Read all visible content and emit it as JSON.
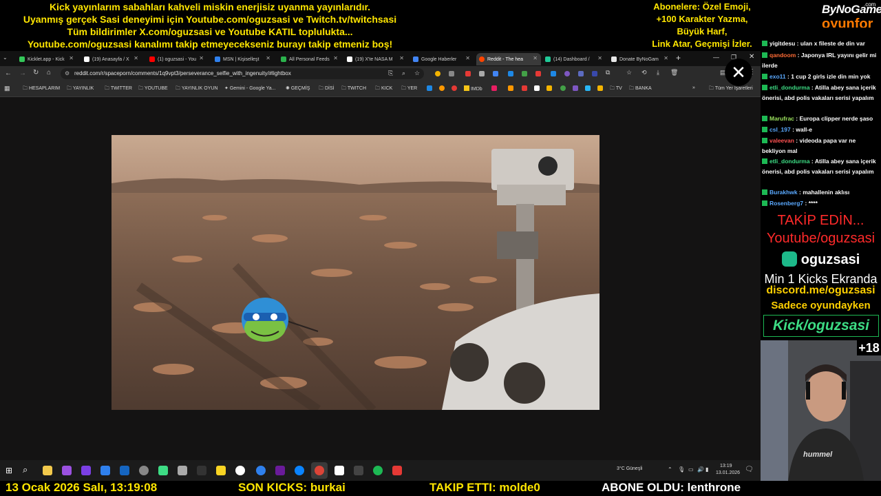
{
  "top_banner": {
    "lines": [
      "Kick yayınlarım sabahları kahveli miskin enerjisiz uyanma yayınlarıdır.",
      "Uyanmış gerçek Sasi deneyimi için Youtube.com/oguzsasi ve Twitch.tv/twitchsasi",
      "Tüm bildirimler X.com/oguzsasi ve Youtube KATIL topluluktа...",
      "Youtube.com/oguzsasi kanalımı takip etmeyecekseniz burayı takip etmeniz boş!"
    ],
    "sub_lines": [
      "Abonelere: Özel Emoji,",
      "+100 Karakter Yazma,",
      "Büyük Harf,",
      "Link Atar, Geçmişi İzler."
    ],
    "logo_top": "ByNoGame",
    "logo_small": ".com",
    "logo_bottom": "oyunfor",
    "colors": {
      "banner_text": "#ffe600",
      "logo_orange": "#ff7a00"
    }
  },
  "browser": {
    "tabs": [
      {
        "label": "Kicklet.app - Kick",
        "icon": "kicklet-icon",
        "color": "#34c759"
      },
      {
        "label": "(19) Anasayfa / X",
        "icon": "x-icon",
        "color": "#ffffff"
      },
      {
        "label": "(1) oguzsasi - You",
        "icon": "youtube-icon",
        "color": "#ff0000"
      },
      {
        "label": "MSN | Kişiselleşt",
        "icon": "msn-icon",
        "color": "#2f80ed"
      },
      {
        "label": "All Personal Feeds",
        "icon": "feedly-icon",
        "color": "#2bb24c"
      },
      {
        "label": "(19) X'te NASA M",
        "icon": "x-icon",
        "color": "#ffffff"
      },
      {
        "label": "Google Haberler",
        "icon": "google-news-icon",
        "color": "#4285f4"
      },
      {
        "label": "Reddit - The hea",
        "icon": "reddit-icon",
        "color": "#ff4500"
      },
      {
        "label": "(14) Dashboard /",
        "icon": "dashboard-icon",
        "color": "#20c997"
      },
      {
        "label": "Donate ByNoGam",
        "icon": "bynogame-icon",
        "color": "#e8e8e8"
      }
    ],
    "active_tab_index": 7,
    "new_tab": "+",
    "url": "reddit.com/r/spaceporn/comments/1q9vpt3/perseverance_selfie_with_ingenuity/#lightbox",
    "bookmarks": [
      "HESAPLARIM",
      "YAYINLIK",
      "TWITTER",
      "YOUTUBE",
      "YAYINLIK OYUN",
      "Gemini - Google Ya...",
      "GEÇMİŞ",
      "DİSİ",
      "TWITCH",
      "KICK",
      "YER",
      "IMDb",
      "TV",
      "BANKA"
    ],
    "all_bookmarks": "Tüm Yer İşaretleri",
    "close_symbol": "✕"
  },
  "taskbar": {
    "weather": "3°C  Güneşli",
    "time": "13:19",
    "date": "13.01.2026"
  },
  "chat": {
    "messages": [
      {
        "user": "yigitdesu",
        "color": "#ffffff",
        "text": "ulan x fileste de din var"
      },
      {
        "user": "qandoom",
        "color": "#ff6b35",
        "text": "Japonya IRL yayını gelir mi ilerde"
      },
      {
        "user": "exo11",
        "color": "#5aa9ff",
        "text": "1 cup 2 girls izle din min yok"
      },
      {
        "user": "etli_dondurma",
        "color": "#3ddc84",
        "text": "Atilla abey sana içerik önerisi, abd polis vakaları serisi yapalım"
      },
      {
        "user": "Marufrac",
        "color": "#9be15d",
        "text": "Europa clipper nerde şaso"
      },
      {
        "user": "csl_197",
        "color": "#5aa9ff",
        "text": "wall-e"
      },
      {
        "user": "valeevan",
        "color": "#ff5252",
        "text": "videoda papa var ne bekliyon mal"
      },
      {
        "user": "etli_dondurma",
        "color": "#3ddc84",
        "text": "Atilla abey sana içerik önerisi, abd polis vakaları serisi yapalım"
      },
      {
        "user": "Burakhwk",
        "color": "#5aa9ff",
        "text": "mahallenin aklısı"
      },
      {
        "user": "Rosenberg7",
        "color": "#5aa9ff",
        "text": "****"
      }
    ]
  },
  "promo": {
    "takip": "TAKİP EDİN...",
    "youtube": "Youtube/oguzsasi",
    "kick_user": "oguzsasi",
    "min_kicks": "Min 1 Kicks Ekranda",
    "discord": "discord.me/oguzsasi",
    "only_game": "Sadece oyundayken",
    "kick_link": "Kick/oguzsasi"
  },
  "cam": {
    "rating": "+18"
  },
  "bottom": {
    "date": "13 Ocak 2026 Salı, 13:19:08",
    "kicks": "SON KICKS: burkai",
    "follow": "TAKIP ETTI: molde0",
    "sub": "ABONE OLDU: lenthrone"
  }
}
